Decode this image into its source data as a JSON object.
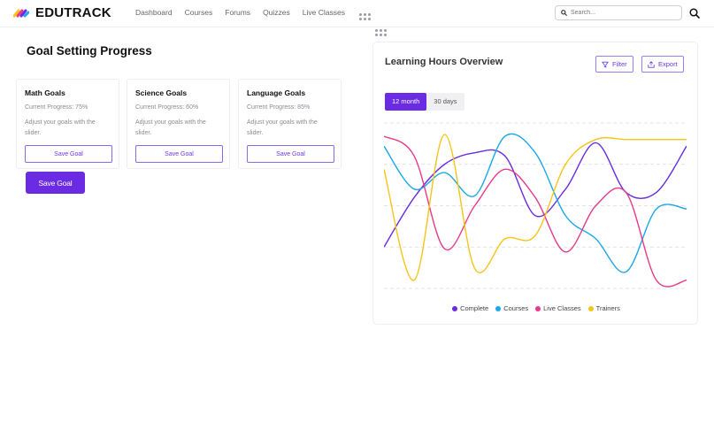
{
  "brand": {
    "name": "EDUTRACK",
    "logo_colors": [
      "#f5c518",
      "#e8398a",
      "#6a2be2"
    ]
  },
  "nav": {
    "items": [
      {
        "label": "Dashboard",
        "active": true
      },
      {
        "label": "Courses",
        "active": false
      },
      {
        "label": "Forums",
        "active": false
      },
      {
        "label": "Quizzes",
        "active": false
      },
      {
        "label": "Live Classes",
        "active": false
      }
    ]
  },
  "search": {
    "placeholder": "Search..."
  },
  "goals": {
    "title": "Goal Setting Progress",
    "cards": [
      {
        "title": "Math Goals",
        "progress": "Current Progress: 75%",
        "hint": "Adjust your goals with the slider.",
        "button": "Save Goal"
      },
      {
        "title": "Science Goals",
        "progress": "Current Progress: 60%",
        "hint": "Adjust your goals with the slider.",
        "button": "Save Goal"
      },
      {
        "title": "Language Goals",
        "progress": "Current Progress: 85%",
        "hint": "Adjust your goals with the slider.",
        "button": "Save Goal"
      }
    ],
    "save_button": "Save Goal"
  },
  "chart_panel": {
    "title": "Learning Hours Overview",
    "filter_label": "Filter",
    "export_label": "Export",
    "ranges": [
      {
        "label": "12 month",
        "active": true
      },
      {
        "label": "30 days",
        "active": false
      }
    ]
  },
  "chart_data": {
    "type": "line",
    "title": "Learning Hours Overview",
    "grid": true,
    "legend": "bottom-center",
    "ylim": [
      0,
      100
    ],
    "x": [
      0,
      1,
      2,
      3,
      4,
      5,
      6,
      7,
      8,
      9,
      10
    ],
    "series": [
      {
        "name": "Complete",
        "color": "#6a2be2",
        "values": [
          25,
          55,
          75,
          82,
          80,
          44,
          60,
          88,
          58,
          58,
          86
        ]
      },
      {
        "name": "Courses",
        "color": "#1aa8e8",
        "values": [
          86,
          60,
          70,
          56,
          92,
          82,
          44,
          30,
          10,
          48,
          48
        ]
      },
      {
        "name": "Live Classes",
        "color": "#e8398a",
        "values": [
          92,
          80,
          24,
          50,
          72,
          55,
          22,
          50,
          58,
          5,
          5
        ]
      },
      {
        "name": "Trainers",
        "color": "#f5c518",
        "values": [
          72,
          5,
          93,
          12,
          30,
          32,
          75,
          90,
          90,
          90,
          90
        ]
      }
    ]
  }
}
